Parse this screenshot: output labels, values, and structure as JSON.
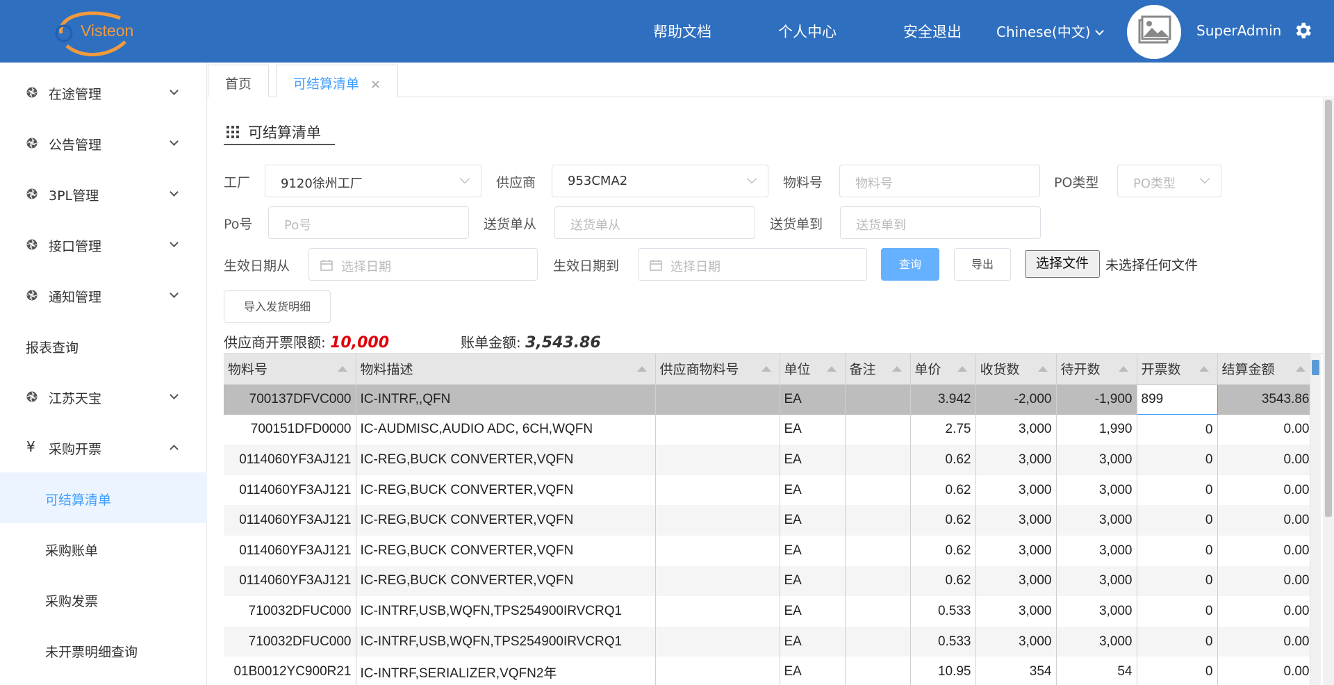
{
  "header": {
    "logo_text": "Visteon",
    "nav": [
      "帮助文档",
      "个人中心",
      "安全退出"
    ],
    "language": "Chinese(中文)",
    "username": "SuperAdmin",
    "brand_color": "#2f6fbf"
  },
  "sidebar": {
    "items": [
      {
        "label": "在途管理",
        "icon": "aperture-icon"
      },
      {
        "label": "公告管理",
        "icon": "aperture-icon"
      },
      {
        "label": "3PL管理",
        "icon": "aperture-icon"
      },
      {
        "label": "接口管理",
        "icon": "aperture-icon"
      },
      {
        "label": "通知管理",
        "icon": "aperture-icon"
      },
      {
        "label": "报表查询"
      },
      {
        "label": "江苏天宝",
        "icon": "aperture-icon"
      },
      {
        "label": "采购开票",
        "icon": "yen-icon",
        "expanded": true
      }
    ],
    "yen_symbol": "¥",
    "subitems": [
      {
        "label": "可结算清单",
        "active": true
      },
      {
        "label": "采购账单"
      },
      {
        "label": "采购发票"
      },
      {
        "label": "未开票明细查询"
      }
    ]
  },
  "tabs": [
    {
      "label": "首页"
    },
    {
      "label": "可结算清单",
      "active": true,
      "close": "×"
    }
  ],
  "page": {
    "title": "可结算清单"
  },
  "filters": {
    "factory_label": "工厂",
    "factory_value": "9120徐州工厂",
    "supplier_label": "供应商",
    "supplier_value": "953CMA2",
    "material_label": "物料号",
    "material_placeholder": "物料号",
    "po_type_label": "PO类型",
    "po_type_placeholder": "PO类型",
    "po_label": "Po号",
    "po_placeholder": "Po号",
    "delivery_from_label": "送货单从",
    "delivery_from_placeholder": "送货单从",
    "delivery_to_label": "送货单到",
    "delivery_to_placeholder": "送货单到",
    "date_from_label": "生效日期从",
    "date_from_placeholder": "选择日期",
    "date_to_label": "生效日期到",
    "date_to_placeholder": "选择日期"
  },
  "buttons": {
    "query": "查询",
    "export": "导出",
    "choose_file": "选择文件",
    "no_file": "未选择任何文件",
    "import": "导入发货明细"
  },
  "summary": {
    "limit_label": "供应商开票限额:",
    "limit_value": "10,000",
    "limit_color": "#e0000a",
    "bill_label": "账单金额:",
    "bill_value": "3,543.86"
  },
  "table": {
    "columns": [
      "物料号",
      "物料描述",
      "供应商物料号",
      "单位",
      "备注",
      "单价",
      "收货数",
      "待开数",
      "开票数",
      "结算金额"
    ],
    "rows": [
      [
        "700137DFVC000",
        "IC-INTRF,,QFN",
        "",
        "EA",
        "",
        "3.942",
        "-2,000",
        "-1,900",
        "899",
        "3543.86"
      ],
      [
        "700151DFD0000",
        "IC-AUDMISC,AUDIO ADC, 6CH,WQFN",
        "",
        "EA",
        "",
        "2.75",
        "3,000",
        "1,990",
        "0",
        "0.00"
      ],
      [
        "0114060YF3AJ121",
        "IC-REG,BUCK CONVERTER,VQFN",
        "",
        "EA",
        "",
        "0.62",
        "3,000",
        "3,000",
        "0",
        "0.00"
      ],
      [
        "0114060YF3AJ121",
        "IC-REG,BUCK CONVERTER,VQFN",
        "",
        "EA",
        "",
        "0.62",
        "3,000",
        "3,000",
        "0",
        "0.00"
      ],
      [
        "0114060YF3AJ121",
        "IC-REG,BUCK CONVERTER,VQFN",
        "",
        "EA",
        "",
        "0.62",
        "3,000",
        "3,000",
        "0",
        "0.00"
      ],
      [
        "0114060YF3AJ121",
        "IC-REG,BUCK CONVERTER,VQFN",
        "",
        "EA",
        "",
        "0.62",
        "3,000",
        "3,000",
        "0",
        "0.00"
      ],
      [
        "0114060YF3AJ121",
        "IC-REG,BUCK CONVERTER,VQFN",
        "",
        "EA",
        "",
        "0.62",
        "3,000",
        "3,000",
        "0",
        "0.00"
      ],
      [
        "710032DFUC000",
        "IC-INTRF,USB,WQFN,TPS254900IRVCRQ1",
        "",
        "EA",
        "",
        "0.533",
        "3,000",
        "3,000",
        "0",
        "0.00"
      ],
      [
        "710032DFUC000",
        "IC-INTRF,USB,WQFN,TPS254900IRVCRQ1",
        "",
        "EA",
        "",
        "0.533",
        "3,000",
        "3,000",
        "0",
        "0.00"
      ],
      [
        "01B0012YC900R21",
        "IC-INTRF,SERIALIZER,VQFN2年",
        "",
        "EA",
        "",
        "10.95",
        "354",
        "54",
        "0",
        "0.00"
      ]
    ]
  }
}
